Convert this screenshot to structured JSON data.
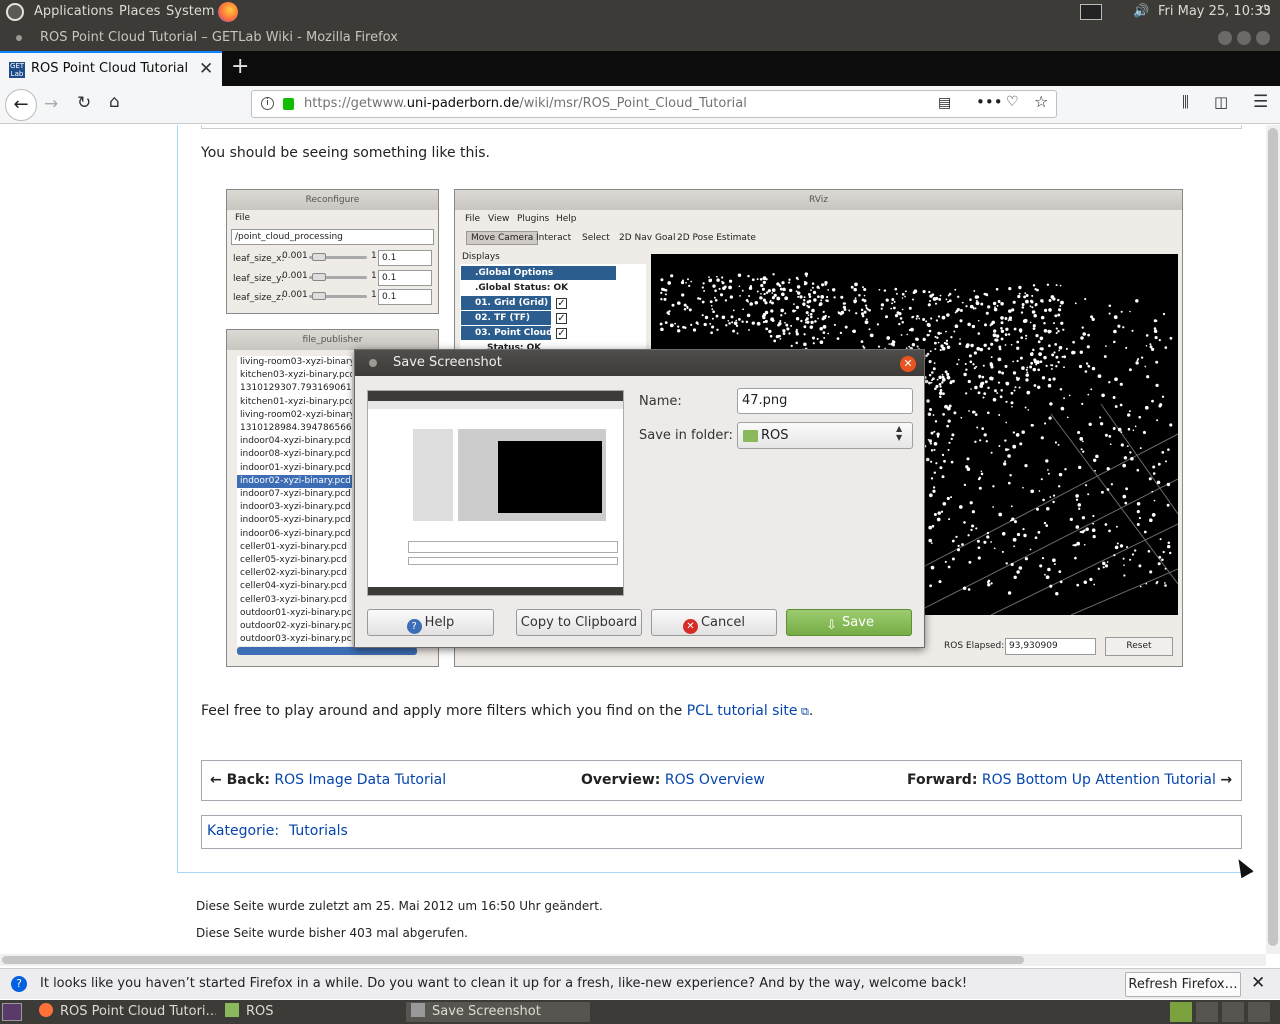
{
  "panel": {
    "menu": [
      "Applications",
      "Places",
      "System"
    ],
    "clock": "Fri May 25, 10:33",
    "icons": [
      "ubuntu-logo-icon",
      "firefox-launcher-icon",
      "terminal-icon",
      "volume-icon",
      "power-icon"
    ]
  },
  "window": {
    "title": "ROS Point Cloud Tutorial – GETLab Wiki - Mozilla Firefox"
  },
  "tabs": [
    {
      "label": "ROS Point Cloud Tutorial – GE",
      "favicon": "GET Lab"
    }
  ],
  "urlbar": {
    "prefix": "https://getwww.",
    "domain": "uni-paderborn.de",
    "path": "/wiki/msr/ROS_Point_Cloud_Tutorial"
  },
  "page": {
    "intro": "You should be seeing something like this.",
    "para2_before": "Feel free to play around and apply more filters which you find on the ",
    "para2_link": "PCL tutorial site",
    "para2_after": ".",
    "nav": {
      "back_label": "← Back:",
      "back_link": "ROS Image Data Tutorial",
      "overview_label": "Overview:",
      "overview_link": "ROS Overview",
      "forward_label": "Forward:",
      "forward_link": "ROS Bottom Up Attention Tutorial",
      "forward_arrow": "→"
    },
    "category_label": "Kategorie:",
    "category_link": "Tutorials",
    "footer": [
      "Diese Seite wurde zuletzt am 25. Mai 2012 um 16:50 Uhr geändert.",
      "Diese Seite wurde bisher 403 mal abgerufen."
    ]
  },
  "shot": {
    "reconfigure": {
      "title": "Reconfigure",
      "menu": "File",
      "node": "/point_cloud_processing",
      "params": [
        {
          "name": "leaf_size_x:",
          "min": "0.001",
          "max": "1",
          "value": "0.1"
        },
        {
          "name": "leaf_size_y:",
          "min": "0.001",
          "max": "1",
          "value": "0.1"
        },
        {
          "name": "leaf_size_z:",
          "min": "0.001",
          "max": "1",
          "value": "0.1"
        }
      ]
    },
    "file_publisher": {
      "title": "file_publisher",
      "files": [
        "living-room03-xyzi-binary.pcd",
        "kitchen03-xyzi-binary.pcd",
        "1310129307.793169061.pcd",
        "kitchen01-xyzi-binary.pcd",
        "living-room02-xyzi-binary.pcd",
        "1310128984.394786566.pcd",
        "indoor04-xyzi-binary.pcd",
        "indoor08-xyzi-binary.pcd",
        "indoor01-xyzi-binary.pcd",
        "indoor02-xyzi-binary.pcd",
        "indoor07-xyzi-binary.pcd",
        "indoor03-xyzi-binary.pcd",
        "indoor05-xyzi-binary.pcd",
        "indoor06-xyzi-binary.pcd",
        "celler01-xyzi-binary.pcd",
        "celler05-xyzi-binary.pcd",
        "celler02-xyzi-binary.pcd",
        "celler04-xyzi-binary.pcd",
        "celler03-xyzi-binary.pcd",
        "outdoor01-xyzi-binary.pcd",
        "outdoor02-xyzi-binary.pcd",
        "outdoor03-xyzi-binary.pcd"
      ],
      "selected": "indoor02-xyzi-binary.pcd"
    },
    "rviz": {
      "title": "RViz",
      "menu": [
        "File",
        "View",
        "Plugins",
        "Help"
      ],
      "tools": [
        "Move Camera",
        "Interact",
        "Select",
        "2D Nav Goal",
        "2D Pose Estimate"
      ],
      "displays_title": "Displays",
      "displays": [
        ".Global Options",
        ".Global Status: OK",
        "01. Grid (Grid)",
        "02. TF (TF)",
        "03. Point Cloud2 (",
        "Status: OK"
      ],
      "ros_elapsed_label": "ROS Elapsed:",
      "ros_elapsed_value": "93,930909",
      "reset": "Reset"
    }
  },
  "dialog": {
    "title": "Save Screenshot",
    "name_label": "Name:",
    "name_value": "47.png",
    "folder_label": "Save in folder:",
    "folder_value": "ROS",
    "buttons": {
      "help": "Help",
      "copy": "Copy to Clipboard",
      "cancel": "Cancel",
      "save": "Save"
    }
  },
  "notification": {
    "message": "It looks like you haven’t started Firefox in a while. Do you want to clean it up for a fresh, like-new experience? And by the way, welcome back!",
    "button": "Refresh Firefox…"
  },
  "taskbar": {
    "items": [
      {
        "label": "ROS Point Cloud Tutori…"
      },
      {
        "label": "ROS"
      },
      {
        "label": "Save Screenshot"
      }
    ]
  },
  "colors": {
    "panel": "#3c3b37",
    "link": "#0645ad",
    "save_button": "#76ad46",
    "close_button": "#e95420",
    "selection": "#3d6db5"
  }
}
